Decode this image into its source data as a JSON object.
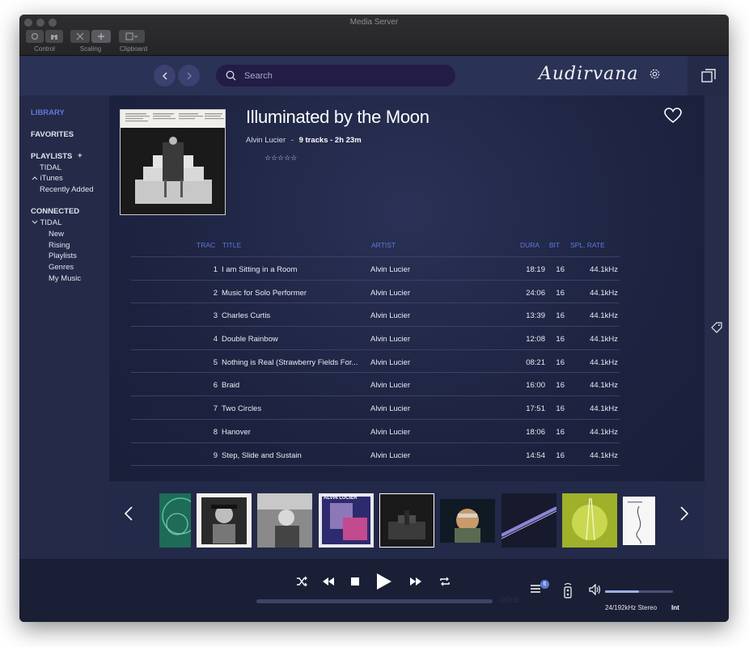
{
  "window": {
    "title": "Media Server"
  },
  "toolbar": {
    "groups": [
      {
        "label": "Control"
      },
      {
        "label": "Scaling"
      },
      {
        "label": "Clipboard"
      }
    ]
  },
  "header": {
    "search_placeholder": "Search",
    "brand": "Audirvana"
  },
  "sidebar": {
    "library": "LIBRARY",
    "favorites": "FAVORITES",
    "playlists": "PLAYLISTS",
    "playlists_add": "+",
    "playlist_items": [
      "TIDAL",
      "iTunes",
      "Recently Added"
    ],
    "connected": "CONNECTED",
    "connected_source": "TIDAL",
    "connected_items": [
      "New",
      "Rising",
      "Playlists",
      "Genres",
      "My Music"
    ]
  },
  "album": {
    "title": "Illuminated by the Moon",
    "artist": "Alvin Lucier",
    "separator": "-",
    "summary": "9 tracks - 2h 23m",
    "rating_text": "☆☆☆☆☆"
  },
  "track_table": {
    "columns": {
      "track": "TRAC",
      "title": "TITLE",
      "artist": "ARTIST",
      "duration": "DURA",
      "bit": "BIT",
      "rate": "SPL. RATE"
    },
    "rows": [
      {
        "num": "1",
        "title": "I am Sitting in a Room",
        "artist": "Alvin Lucier",
        "duration": "18:19",
        "bit": "16",
        "rate": "44.1kHz"
      },
      {
        "num": "2",
        "title": "Music for Solo Performer",
        "artist": "Alvin Lucier",
        "duration": "24:06",
        "bit": "16",
        "rate": "44.1kHz"
      },
      {
        "num": "3",
        "title": "Charles Curtis",
        "artist": "Alvin Lucier",
        "duration": "13:39",
        "bit": "16",
        "rate": "44.1kHz"
      },
      {
        "num": "4",
        "title": "Double Rainbow",
        "artist": "Alvin Lucier",
        "duration": "12:08",
        "bit": "16",
        "rate": "44.1kHz"
      },
      {
        "num": "5",
        "title": "Nothing is Real (Strawberry Fields For...",
        "artist": "Alvin Lucier",
        "duration": "08:21",
        "bit": "16",
        "rate": "44.1kHz"
      },
      {
        "num": "6",
        "title": "Braid",
        "artist": "Alvin Lucier",
        "duration": "16:00",
        "bit": "16",
        "rate": "44.1kHz"
      },
      {
        "num": "7",
        "title": "Two Circles",
        "artist": "Alvin Lucier",
        "duration": "17:51",
        "bit": "16",
        "rate": "44.1kHz"
      },
      {
        "num": "8",
        "title": "Hanover",
        "artist": "Alvin Lucier",
        "duration": "18:06",
        "bit": "16",
        "rate": "44.1kHz"
      },
      {
        "num": "9",
        "title": "Step, Slide and Sustain",
        "artist": "Alvin Lucier",
        "duration": "14:54",
        "bit": "16",
        "rate": "44.1kHz"
      }
    ]
  },
  "carousel": {
    "thumbnail_text": "ALVIN LUCIER"
  },
  "player": {
    "queue_count": "6",
    "time_remaining": "-00:00",
    "format": "24/192kHz Stereo",
    "output": "Int",
    "volume_level": 0.5
  },
  "colors": {
    "accent": "#5f7ad8",
    "background": "#1c2238",
    "sidebar": "#242a48"
  }
}
